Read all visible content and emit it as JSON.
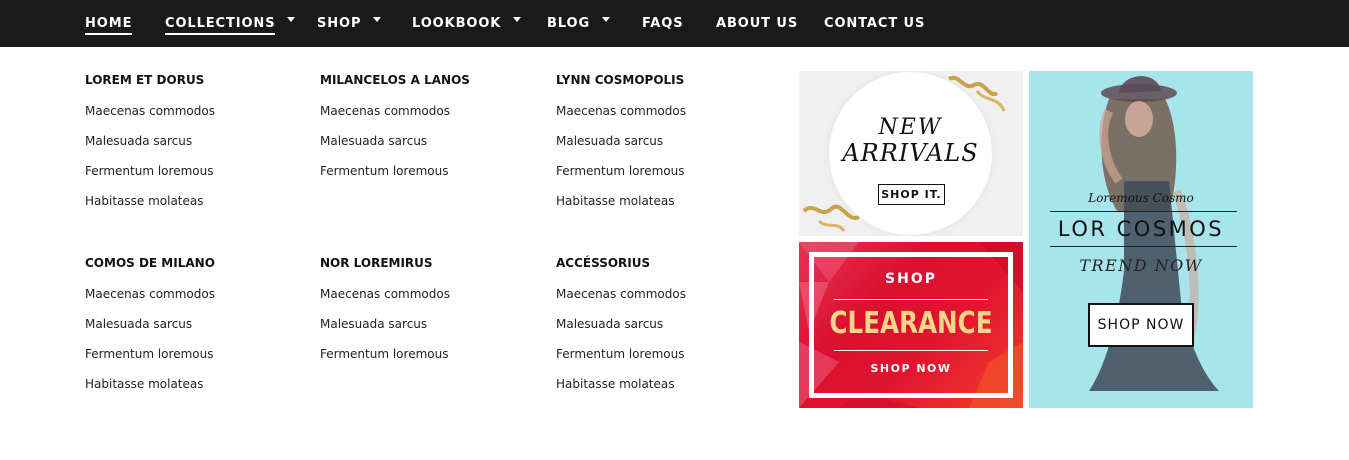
{
  "nav": {
    "items": [
      {
        "label": "HOME",
        "active": true
      },
      {
        "label": "COLLECTIONS",
        "active": true
      },
      {
        "label": "SHOP"
      },
      {
        "label": "LOOKBOOK"
      },
      {
        "label": "BLOG"
      },
      {
        "label": "FAQS"
      },
      {
        "label": "ABOUT US"
      },
      {
        "label": "CONTACT US"
      }
    ]
  },
  "menu": {
    "groups": [
      {
        "title": "LOREM ET DORUS",
        "links": [
          "Maecenas commodos",
          "Malesuada sarcus",
          "Fermentum loremous",
          "Habitasse molateas"
        ]
      },
      {
        "title": "MILANCELOS A LANOS",
        "links": [
          "Maecenas commodos",
          "Malesuada sarcus",
          "Fermentum loremous"
        ]
      },
      {
        "title": "LYNN COSMOPOLIS",
        "links": [
          "Maecenas commodos",
          "Malesuada sarcus",
          "Fermentum loremous",
          "Habitasse molateas"
        ]
      },
      {
        "title": "COMOS DE MILANO",
        "links": [
          "Maecenas commodos",
          "Malesuada sarcus",
          "Fermentum loremous",
          "Habitasse molateas"
        ]
      },
      {
        "title": "NOR LOREMIRUS",
        "links": [
          "Maecenas commodos",
          "Malesuada sarcus",
          "Fermentum loremous"
        ]
      },
      {
        "title": "ACCÉSSORIUS",
        "links": [
          "Maecenas commodos",
          "Malesuada sarcus",
          "Fermentum loremous",
          "Habitasse molateas"
        ]
      }
    ]
  },
  "banners": {
    "new_arrivals": {
      "line1": "NEW",
      "line2": "ARRIVALS",
      "button": "SHOP IT."
    },
    "clearance": {
      "top": "SHOP",
      "big": "CLEARANCE",
      "bottom": "SHOP NOW"
    },
    "cosmos": {
      "sub": "Loremous Cosmo",
      "title": "LOR COSMOS",
      "trend": "TREND NOW",
      "button": "SHOP NOW"
    }
  },
  "colors": {
    "nav_bg": "#1a1a1a",
    "clearance_red": "#d9102e",
    "clearance_gold": "#f7d58a",
    "cosmos_bg": "#a8e4ec"
  }
}
